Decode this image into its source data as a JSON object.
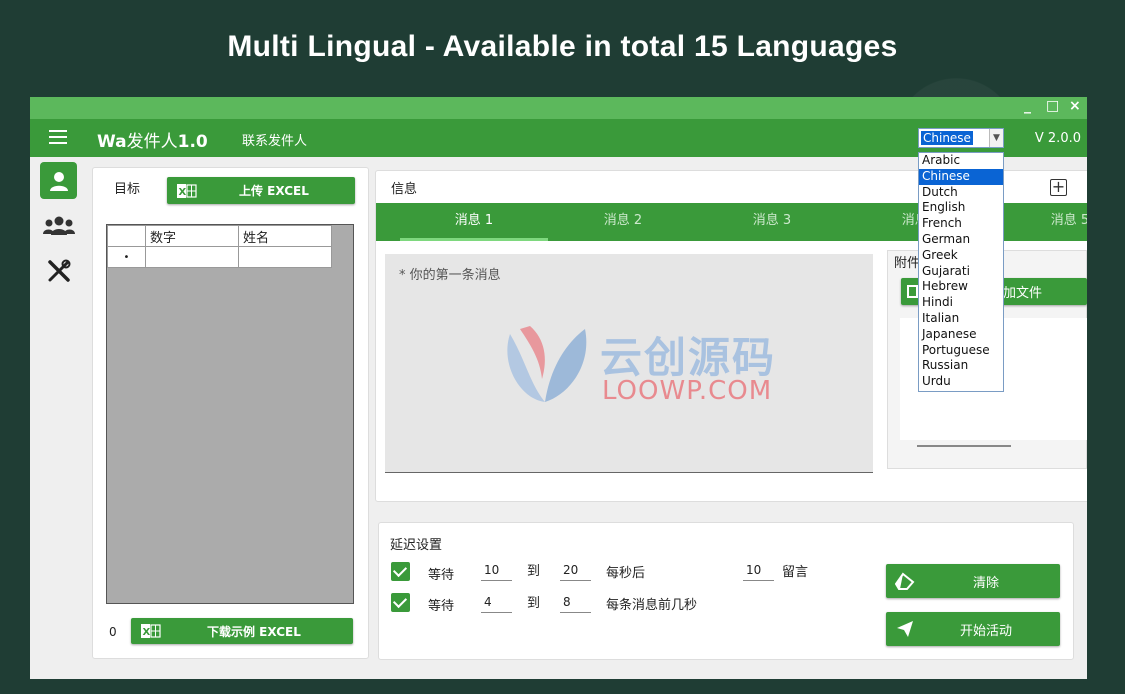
{
  "banner": {
    "text": "Multi Lingual - Available in total 15 Languages"
  },
  "window": {
    "minimize": "_",
    "maximize": "□",
    "close": "×"
  },
  "header": {
    "brand": "Wa",
    "title_cn": "发件人",
    "title_ver": "1.0",
    "contact_link": "联系发件人",
    "version": "V 2.0.0"
  },
  "language": {
    "selected": "Chinese",
    "options": [
      "Arabic",
      "Chinese",
      "Dutch",
      "English",
      "French",
      "German",
      "Greek",
      "Gujarati",
      "Hebrew",
      "Hindi",
      "Italian",
      "Japanese",
      "Portuguese",
      "Russian",
      "Urdu"
    ]
  },
  "targets": {
    "label": "目标",
    "upload_button": "上传 EXCEL",
    "columns": [
      "数字",
      "姓名"
    ],
    "row_marker": "•",
    "count": "0",
    "download_button": "下载示例 EXCEL"
  },
  "message": {
    "label": "信息",
    "add_icon": "+",
    "tabs": [
      "消息 1",
      "消息 2",
      "消息 3",
      "消息 4",
      "消息 5"
    ],
    "placeholder": "* 你的第一条消息",
    "attachment_label": "附件",
    "add_file_button": "加文件"
  },
  "delay": {
    "label": "延迟设置",
    "row1": {
      "wait": "等待",
      "from": "10",
      "to_label": "到",
      "to": "20",
      "suffix": "每秒后",
      "count": "10",
      "count_label": "留言"
    },
    "row2": {
      "wait": "等待",
      "from": "4",
      "to_label": "到",
      "to": "8",
      "suffix": "每条消息前几秒"
    },
    "clear_button": "清除",
    "start_button": "开始活动"
  },
  "watermark": {
    "cn": "云创源码",
    "en": "LOOWP.COM"
  },
  "colors": {
    "accent": "#3a9a3a",
    "titlebar": "#5cb85c",
    "selection": "#0a64d4"
  }
}
